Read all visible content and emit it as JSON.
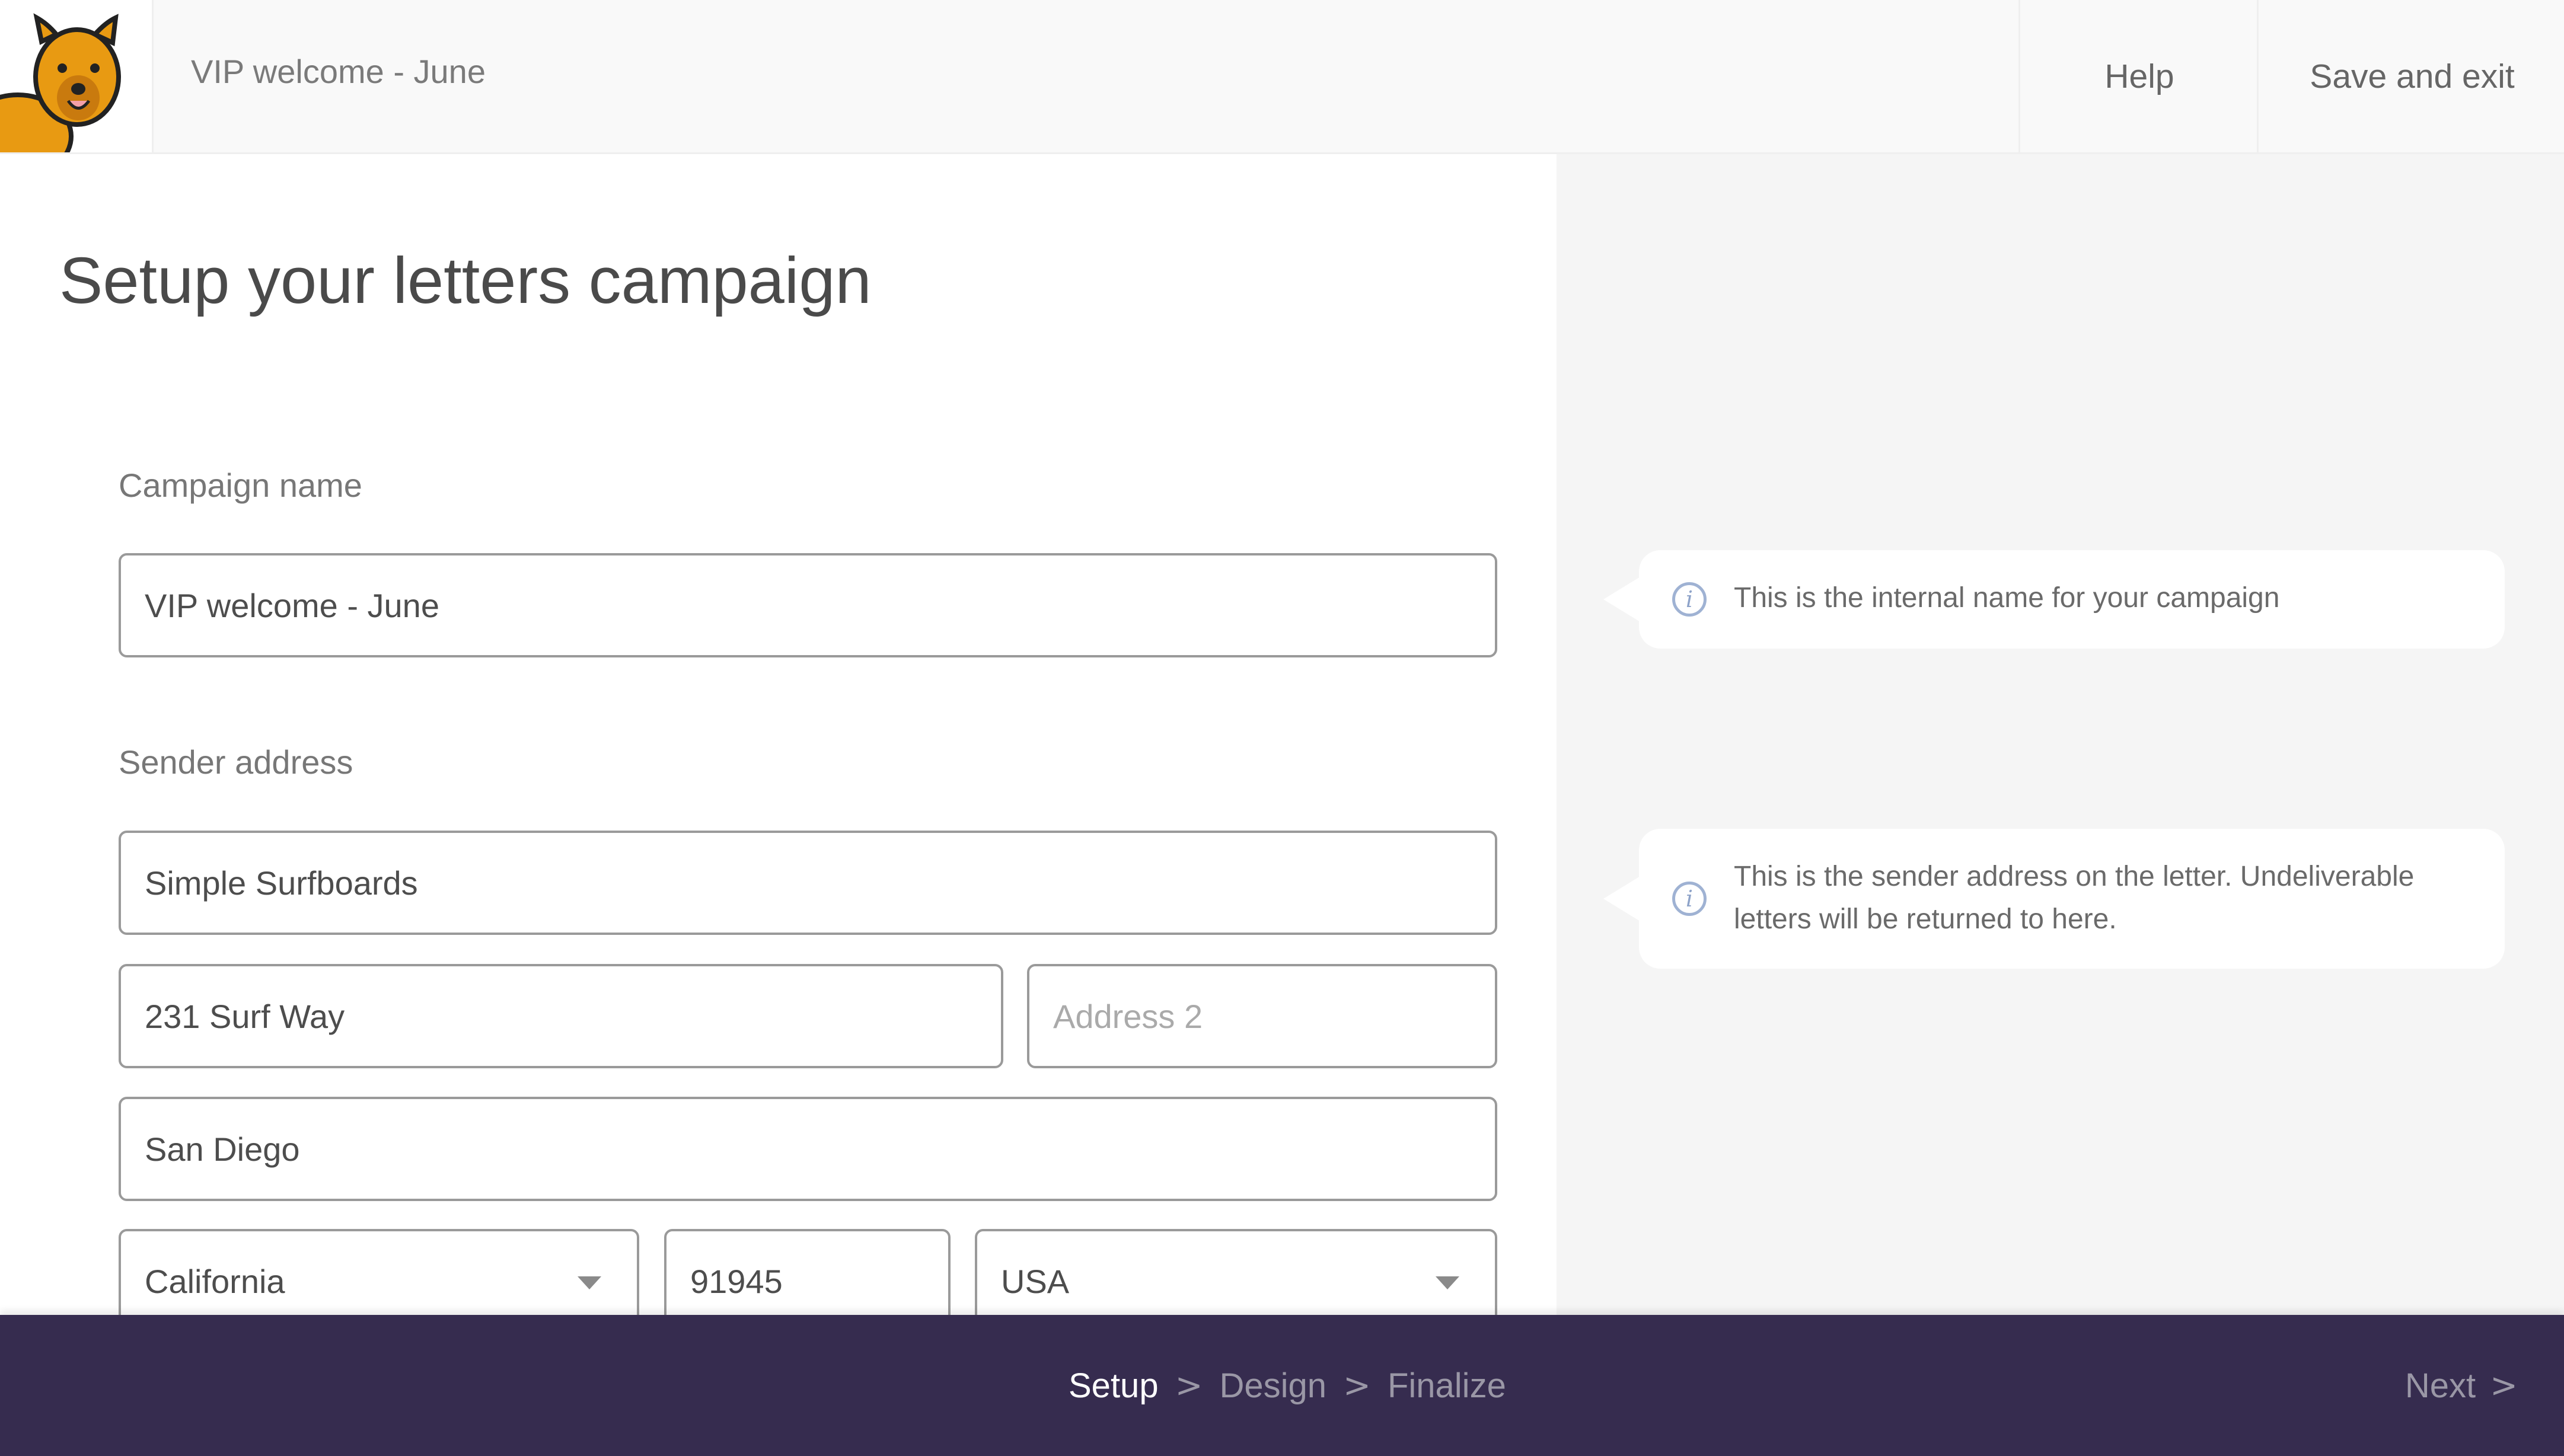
{
  "header": {
    "campaign_title": "VIP welcome - June",
    "help_label": "Help",
    "save_exit_label": "Save and exit",
    "logo_icon": "quokka-mascot-icon"
  },
  "main": {
    "page_title": "Setup your letters campaign",
    "campaign_name": {
      "label": "Campaign name",
      "value": "VIP welcome - June"
    },
    "sender_address": {
      "label": "Sender address",
      "name": "Simple Surfboards",
      "address1": "231 Surf Way",
      "address2_placeholder": "Address 2",
      "city": "San Diego",
      "state": "California",
      "zip": "91945",
      "country": "USA"
    }
  },
  "tips": {
    "campaign_name": "This is the internal name for your campaign",
    "sender_address": "This is the sender address on the letter. Undeliverable letters will be returned to here.",
    "icon": "info-icon"
  },
  "footer": {
    "steps": [
      {
        "label": "Setup",
        "active": true
      },
      {
        "label": "Design",
        "active": false
      },
      {
        "label": "Finalize",
        "active": false
      }
    ],
    "separator": ">",
    "next_label": "Next",
    "bg_color": "#362c4f"
  }
}
